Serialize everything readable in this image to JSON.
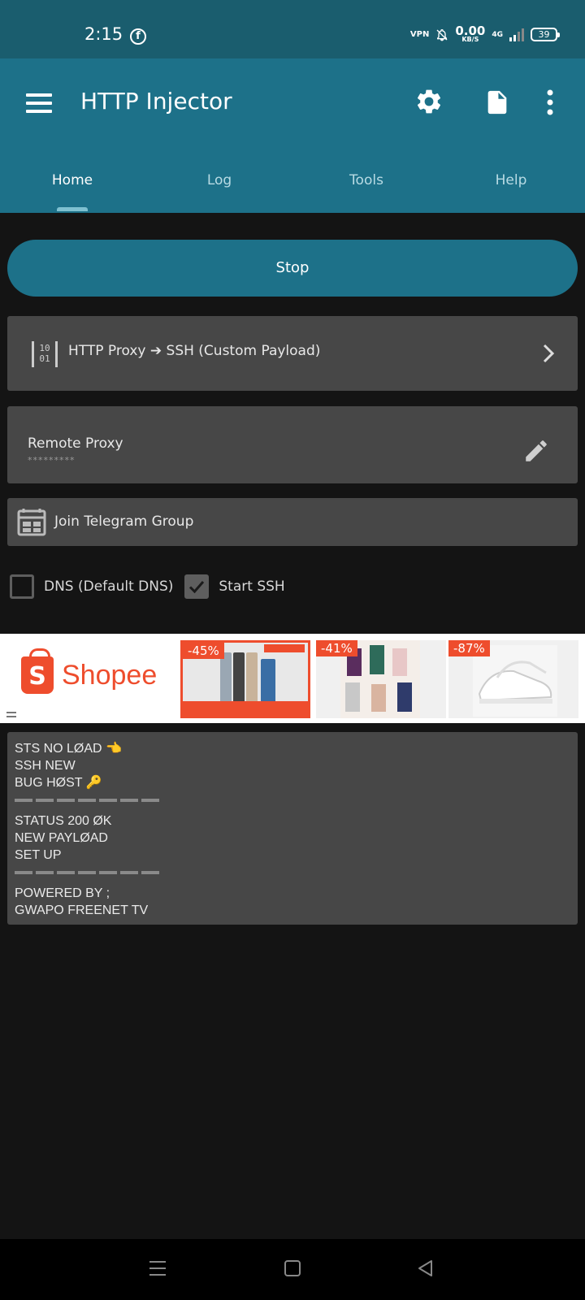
{
  "status_bar": {
    "time": "2:15",
    "facebook_icon": "facebook-icon",
    "vpn": "VPN",
    "speed_value": "0.00",
    "speed_unit": "KB/S",
    "network": "4G",
    "battery": "39"
  },
  "app_bar": {
    "title": "HTTP Injector",
    "icons": [
      "menu-icon",
      "settings-icon",
      "file-icon",
      "more-icon"
    ]
  },
  "tabs": [
    {
      "label": "Home",
      "active": true
    },
    {
      "label": "Log",
      "active": false
    },
    {
      "label": "Tools",
      "active": false
    },
    {
      "label": "Help",
      "active": false
    }
  ],
  "main": {
    "stop_label": "Stop",
    "mode_text": "HTTP Proxy ➔ SSH (Custom Payload)",
    "remote_proxy_label": "Remote Proxy",
    "remote_proxy_value": "*********",
    "telegram_label": "Join Telegram Group",
    "dns_label": "DNS (Default DNS)",
    "dns_checked": false,
    "ssh_label": "Start SSH",
    "ssh_checked": true
  },
  "ad": {
    "brand": "Shopee",
    "deals": [
      {
        "discount": "-45%",
        "image": "phones-image"
      },
      {
        "discount": "-41%",
        "image": "pajamas-image"
      },
      {
        "discount": "-87%",
        "image": "sneakers-image"
      }
    ]
  },
  "description": {
    "block1": [
      "STS NO LØAD 👈",
      "SSH NEW",
      "BUG HØST 🔑"
    ],
    "block2": [
      "STATUS 200 ØK",
      "NEW PAYLØAD",
      "SET UP"
    ],
    "block3": [
      "POWERED BY ;",
      "GWAPO FREENET TV"
    ]
  },
  "colors": {
    "status_bar": "#1a5d6e",
    "app_bar": "#1d7189",
    "background": "#141414",
    "card": "#474747",
    "shopee": "#ee4d2d"
  }
}
